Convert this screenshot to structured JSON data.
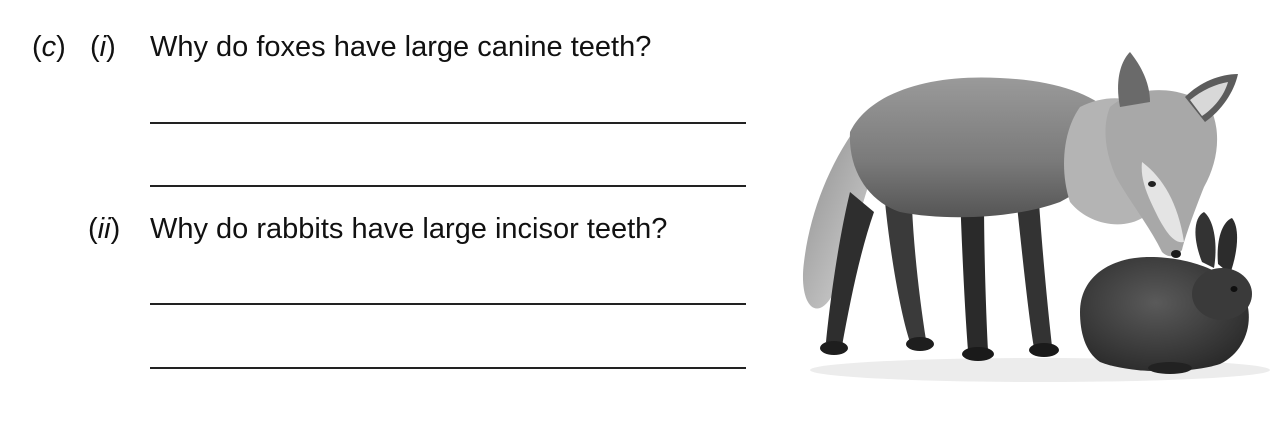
{
  "question": {
    "part_label": "c",
    "subparts": [
      {
        "label": "i",
        "text": "Why do foxes have large canine teeth?"
      },
      {
        "label": "ii",
        "text": "Why do rabbits have large incisor teeth?"
      }
    ]
  },
  "illustration": {
    "subject": "fox and rabbit photograph",
    "style": "greyscale"
  }
}
